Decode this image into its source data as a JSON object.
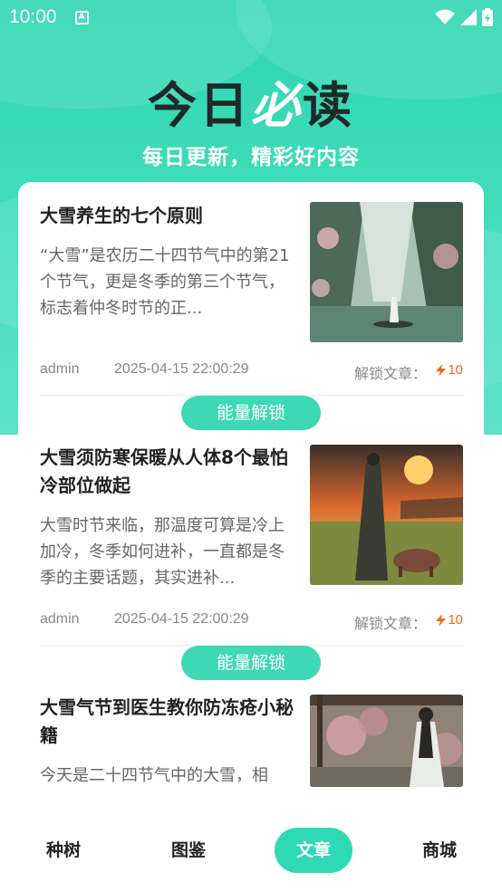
{
  "status_bar": {
    "time": "10:00",
    "icons": [
      "notification-a-icon",
      "wifi-icon",
      "signal-icon",
      "battery-charging-icon"
    ]
  },
  "hero": {
    "title_part1": "今日",
    "title_accent": "必",
    "title_part2": "读",
    "subtitle": "每日更新，精彩好内容"
  },
  "articles": [
    {
      "title": "大雪养生的七个原则",
      "excerpt": "“大雪”是农历二十四节气中的第21个节气，更是冬季的第三个节气，标志着仲冬时节的正...",
      "author": "admin",
      "date": "2025-04-15 22:00:29",
      "unlock_label": "解锁文章：",
      "cost": "10",
      "image": "misty-mountain-river-painting"
    },
    {
      "title": "大雪须防寒保暖从人体8个最怕冷部位做起",
      "excerpt": "大雪时节来临，那温度可算是冷上加冷，冬季如何进补，一直都是冬季的主要话题，其实进补...",
      "author": "admin",
      "date": "2025-04-15 22:00:29",
      "unlock_label": "解锁文章：",
      "cost": "10",
      "image": "sunset-figure-with-pig-painting"
    },
    {
      "title": "大雪气节到医生教你防冻疮小秘籍",
      "excerpt": "今天是二十四节气中的大雪，相",
      "image": "woman-under-blossom-tree-painting"
    }
  ],
  "unlock_button_label": "能量解锁",
  "tabbar": {
    "tabs": [
      {
        "label": "种树",
        "active": false
      },
      {
        "label": "图鉴",
        "active": false
      },
      {
        "label": "文章",
        "active": true
      },
      {
        "label": "商城",
        "active": false
      }
    ]
  },
  "colors": {
    "brand": "#2fd9b3",
    "cost": "#f06a1c"
  }
}
